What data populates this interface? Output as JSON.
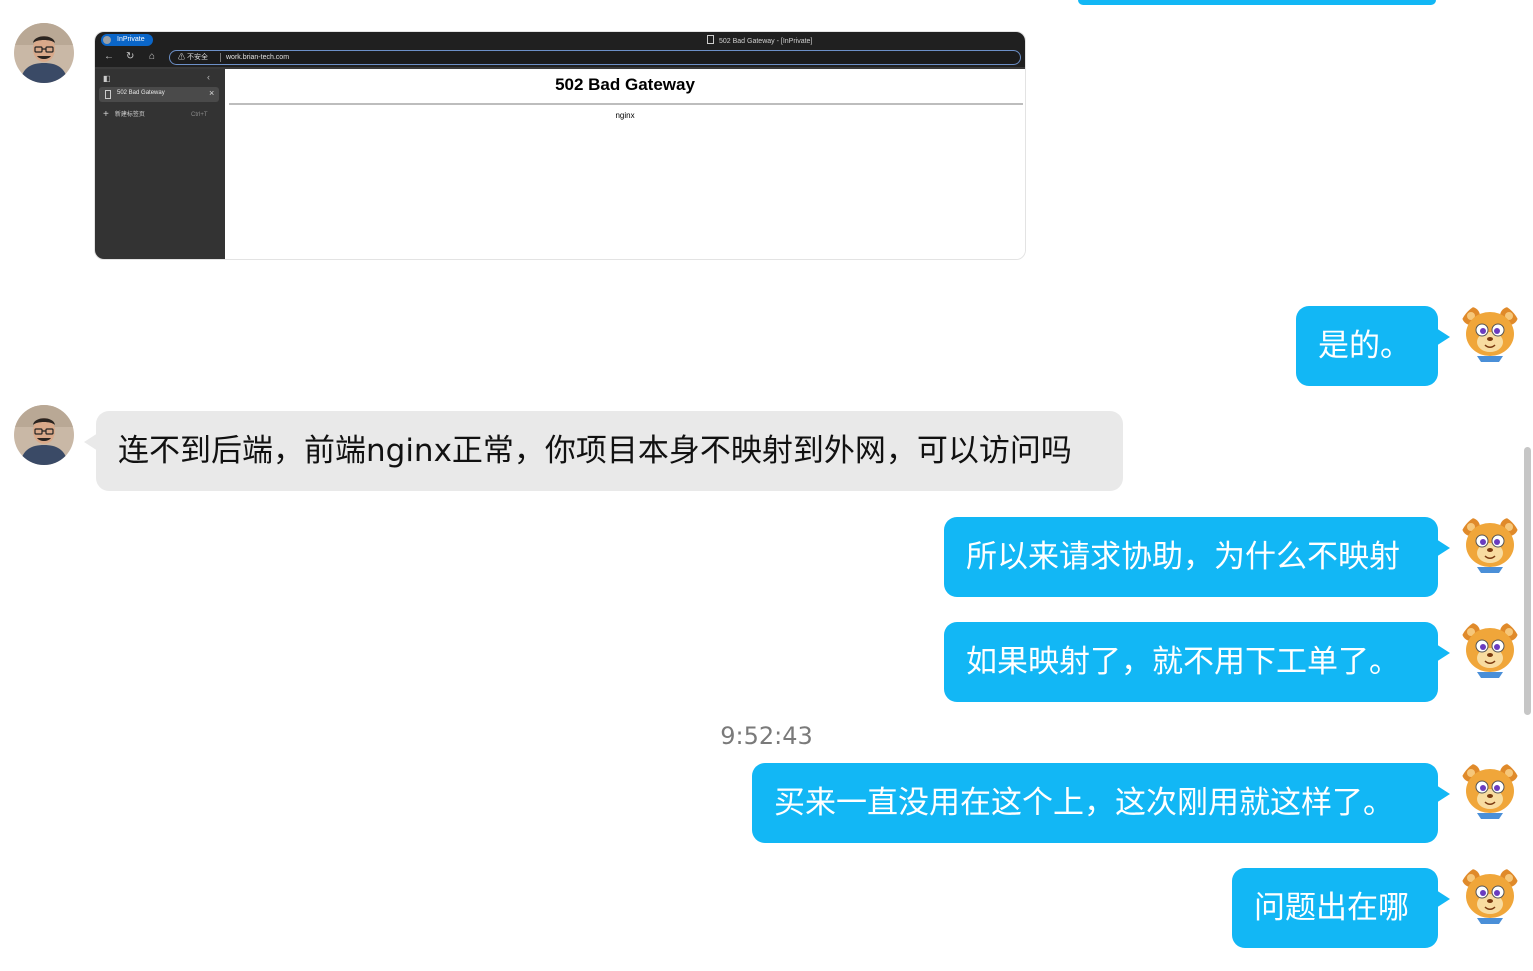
{
  "screenshot": {
    "badge": "InPrivate",
    "window_title": "502 Bad Gateway - [InPrivate]",
    "insecure_label": "不安全",
    "url": "work.brian-tech.com",
    "tab_title": "502 Bad Gateway",
    "new_tab_label": "新建标签页",
    "new_tab_shortcut": "Ctrl+T",
    "page_heading": "502 Bad Gateway",
    "page_server": "nginx"
  },
  "messages": [
    {
      "side": "out",
      "text": "是的。"
    },
    {
      "side": "in",
      "text": "连不到后端，前端nginx正常，你项目本身不映射到外网，可以访问吗"
    },
    {
      "side": "out",
      "text": "所以来请求协助，为什么不映射"
    },
    {
      "side": "out",
      "text": "如果映射了，就不用下工单了。"
    },
    {
      "side": "out",
      "text": "买来一直没用在这个上，这次刚用就这样了。"
    },
    {
      "side": "out",
      "text": "问题出在哪"
    }
  ],
  "timestamp": "9:52:43",
  "colors": {
    "outgoing_bubble": "#12b7f5",
    "incoming_bubble": "#e9e9e9"
  }
}
